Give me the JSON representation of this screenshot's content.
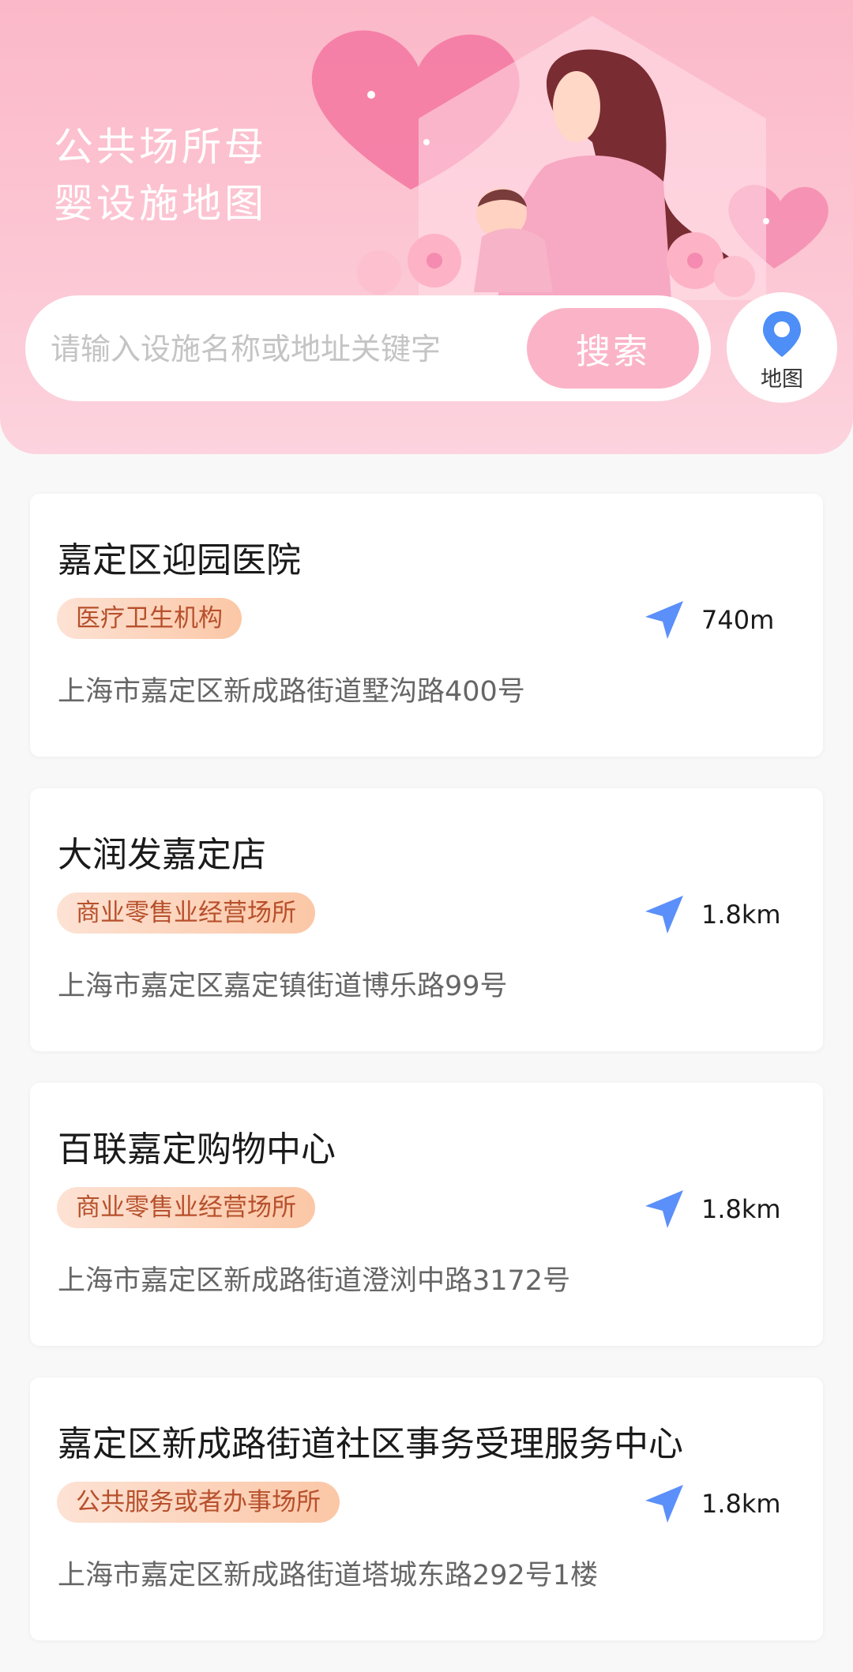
{
  "banner": {
    "title": "公共场所母\n婴设施地图"
  },
  "search": {
    "placeholder": "请输入设施名称或地址关键字",
    "button_label": "搜索"
  },
  "map_button": {
    "label": "地图",
    "icon": "location-pin-icon"
  },
  "colors": {
    "header_pink": "#fbb8c8",
    "search_button": "#fbb4c7",
    "tag_text": "#b7502c",
    "nav_blue": "#5b8ff9"
  },
  "facilities": [
    {
      "name": "嘉定区迎园医院",
      "category": "医疗卫生机构",
      "distance": "740m",
      "address": "上海市嘉定区新成路街道墅沟路400号"
    },
    {
      "name": "大润发嘉定店",
      "category": "商业零售业经营场所",
      "distance": "1.8km",
      "address": "上海市嘉定区嘉定镇街道博乐路99号"
    },
    {
      "name": "百联嘉定购物中心",
      "category": "商业零售业经营场所",
      "distance": "1.8km",
      "address": "上海市嘉定区新成路街道澄浏中路3172号"
    },
    {
      "name": "嘉定区新成路街道社区事务受理服务中心",
      "category": "公共服务或者办事场所",
      "distance": "1.8km",
      "address": "上海市嘉定区新成路街道塔城东路292号1楼"
    }
  ]
}
